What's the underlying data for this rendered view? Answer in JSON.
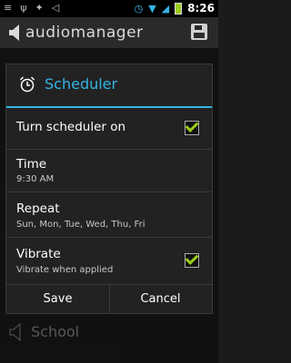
{
  "status": {
    "time": "8:26"
  },
  "app": {
    "title": "audiomanager"
  },
  "background_item": {
    "label": "School"
  },
  "dialog": {
    "title": "Scheduler",
    "rows": [
      {
        "label": "Turn scheduler on",
        "checked": true
      },
      {
        "label": "Time",
        "sub": "9:30 AM"
      },
      {
        "label": "Repeat",
        "sub": "Sun, Mon, Tue, Wed, Thu, Fri"
      },
      {
        "label": "Vibrate",
        "sub": "Vibrate when applied",
        "checked": true
      }
    ],
    "buttons": {
      "save": "Save",
      "cancel": "Cancel"
    }
  },
  "colors": {
    "accent": "#33b5e5",
    "check": "#9ccc1e"
  }
}
